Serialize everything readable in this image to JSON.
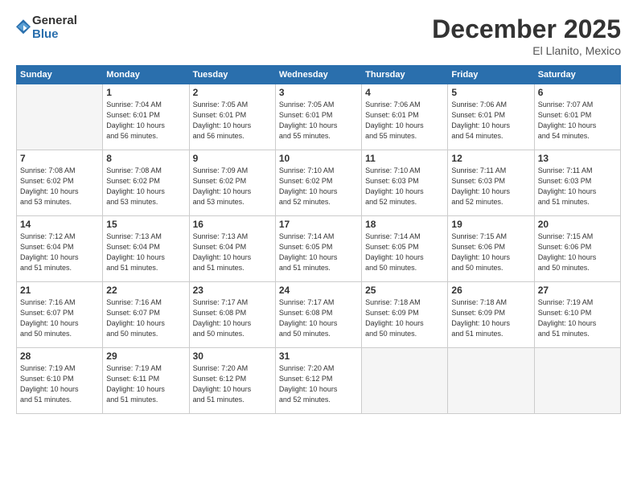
{
  "logo": {
    "general": "General",
    "blue": "Blue"
  },
  "header": {
    "month": "December 2025",
    "location": "El Llanito, Mexico"
  },
  "weekdays": [
    "Sunday",
    "Monday",
    "Tuesday",
    "Wednesday",
    "Thursday",
    "Friday",
    "Saturday"
  ],
  "weeks": [
    [
      {
        "day": "",
        "info": ""
      },
      {
        "day": "1",
        "info": "Sunrise: 7:04 AM\nSunset: 6:01 PM\nDaylight: 10 hours\nand 56 minutes."
      },
      {
        "day": "2",
        "info": "Sunrise: 7:05 AM\nSunset: 6:01 PM\nDaylight: 10 hours\nand 56 minutes."
      },
      {
        "day": "3",
        "info": "Sunrise: 7:05 AM\nSunset: 6:01 PM\nDaylight: 10 hours\nand 55 minutes."
      },
      {
        "day": "4",
        "info": "Sunrise: 7:06 AM\nSunset: 6:01 PM\nDaylight: 10 hours\nand 55 minutes."
      },
      {
        "day": "5",
        "info": "Sunrise: 7:06 AM\nSunset: 6:01 PM\nDaylight: 10 hours\nand 54 minutes."
      },
      {
        "day": "6",
        "info": "Sunrise: 7:07 AM\nSunset: 6:01 PM\nDaylight: 10 hours\nand 54 minutes."
      }
    ],
    [
      {
        "day": "7",
        "info": "Sunrise: 7:08 AM\nSunset: 6:02 PM\nDaylight: 10 hours\nand 53 minutes."
      },
      {
        "day": "8",
        "info": "Sunrise: 7:08 AM\nSunset: 6:02 PM\nDaylight: 10 hours\nand 53 minutes."
      },
      {
        "day": "9",
        "info": "Sunrise: 7:09 AM\nSunset: 6:02 PM\nDaylight: 10 hours\nand 53 minutes."
      },
      {
        "day": "10",
        "info": "Sunrise: 7:10 AM\nSunset: 6:02 PM\nDaylight: 10 hours\nand 52 minutes."
      },
      {
        "day": "11",
        "info": "Sunrise: 7:10 AM\nSunset: 6:03 PM\nDaylight: 10 hours\nand 52 minutes."
      },
      {
        "day": "12",
        "info": "Sunrise: 7:11 AM\nSunset: 6:03 PM\nDaylight: 10 hours\nand 52 minutes."
      },
      {
        "day": "13",
        "info": "Sunrise: 7:11 AM\nSunset: 6:03 PM\nDaylight: 10 hours\nand 51 minutes."
      }
    ],
    [
      {
        "day": "14",
        "info": "Sunrise: 7:12 AM\nSunset: 6:04 PM\nDaylight: 10 hours\nand 51 minutes."
      },
      {
        "day": "15",
        "info": "Sunrise: 7:13 AM\nSunset: 6:04 PM\nDaylight: 10 hours\nand 51 minutes."
      },
      {
        "day": "16",
        "info": "Sunrise: 7:13 AM\nSunset: 6:04 PM\nDaylight: 10 hours\nand 51 minutes."
      },
      {
        "day": "17",
        "info": "Sunrise: 7:14 AM\nSunset: 6:05 PM\nDaylight: 10 hours\nand 51 minutes."
      },
      {
        "day": "18",
        "info": "Sunrise: 7:14 AM\nSunset: 6:05 PM\nDaylight: 10 hours\nand 50 minutes."
      },
      {
        "day": "19",
        "info": "Sunrise: 7:15 AM\nSunset: 6:06 PM\nDaylight: 10 hours\nand 50 minutes."
      },
      {
        "day": "20",
        "info": "Sunrise: 7:15 AM\nSunset: 6:06 PM\nDaylight: 10 hours\nand 50 minutes."
      }
    ],
    [
      {
        "day": "21",
        "info": "Sunrise: 7:16 AM\nSunset: 6:07 PM\nDaylight: 10 hours\nand 50 minutes."
      },
      {
        "day": "22",
        "info": "Sunrise: 7:16 AM\nSunset: 6:07 PM\nDaylight: 10 hours\nand 50 minutes."
      },
      {
        "day": "23",
        "info": "Sunrise: 7:17 AM\nSunset: 6:08 PM\nDaylight: 10 hours\nand 50 minutes."
      },
      {
        "day": "24",
        "info": "Sunrise: 7:17 AM\nSunset: 6:08 PM\nDaylight: 10 hours\nand 50 minutes."
      },
      {
        "day": "25",
        "info": "Sunrise: 7:18 AM\nSunset: 6:09 PM\nDaylight: 10 hours\nand 50 minutes."
      },
      {
        "day": "26",
        "info": "Sunrise: 7:18 AM\nSunset: 6:09 PM\nDaylight: 10 hours\nand 51 minutes."
      },
      {
        "day": "27",
        "info": "Sunrise: 7:19 AM\nSunset: 6:10 PM\nDaylight: 10 hours\nand 51 minutes."
      }
    ],
    [
      {
        "day": "28",
        "info": "Sunrise: 7:19 AM\nSunset: 6:10 PM\nDaylight: 10 hours\nand 51 minutes."
      },
      {
        "day": "29",
        "info": "Sunrise: 7:19 AM\nSunset: 6:11 PM\nDaylight: 10 hours\nand 51 minutes."
      },
      {
        "day": "30",
        "info": "Sunrise: 7:20 AM\nSunset: 6:12 PM\nDaylight: 10 hours\nand 51 minutes."
      },
      {
        "day": "31",
        "info": "Sunrise: 7:20 AM\nSunset: 6:12 PM\nDaylight: 10 hours\nand 52 minutes."
      },
      {
        "day": "",
        "info": ""
      },
      {
        "day": "",
        "info": ""
      },
      {
        "day": "",
        "info": ""
      }
    ]
  ]
}
